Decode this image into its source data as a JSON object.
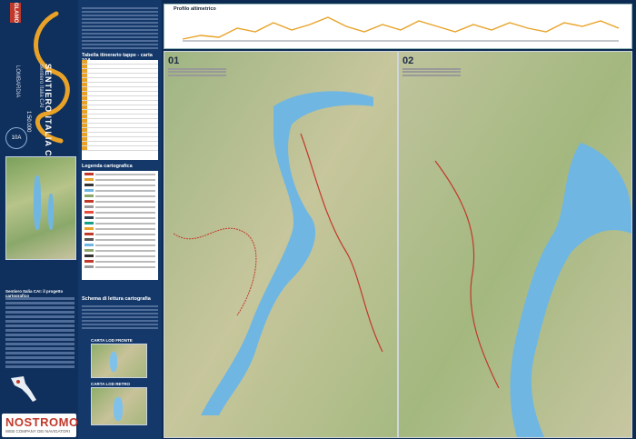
{
  "cover": {
    "brand": "GLAMO",
    "title": "SENTIERO ITALIA CAI",
    "subtitle": "Sentiero Italia CAI",
    "region": "LOMBARDIA",
    "code": "10A",
    "scale": "1:50.000",
    "section_heading": "Sentiero Italia CAI: il progetto cartografico",
    "logo_name": "NOSTROMO",
    "logo_tagline": "WEB COMPANY DEI NAVIGATORI"
  },
  "info": {
    "table_title": "Tabella itinerario tappe - carta 10A",
    "legend_title": "Legenda cartografica",
    "scheme_title": "Schema di lettura cartografia",
    "panel1_title": "CARTA LOD FRONTE",
    "panel2_title": "CARTA LOD RETRO"
  },
  "profile": {
    "title": "Profilo altimetrico"
  },
  "maps": [
    {
      "number": "01"
    },
    {
      "number": "02"
    }
  ],
  "colors": {
    "cover_bg": "#0f2f5c",
    "accent": "#e8a227",
    "route": "#c0392b",
    "lake": "#6fb6e3"
  }
}
